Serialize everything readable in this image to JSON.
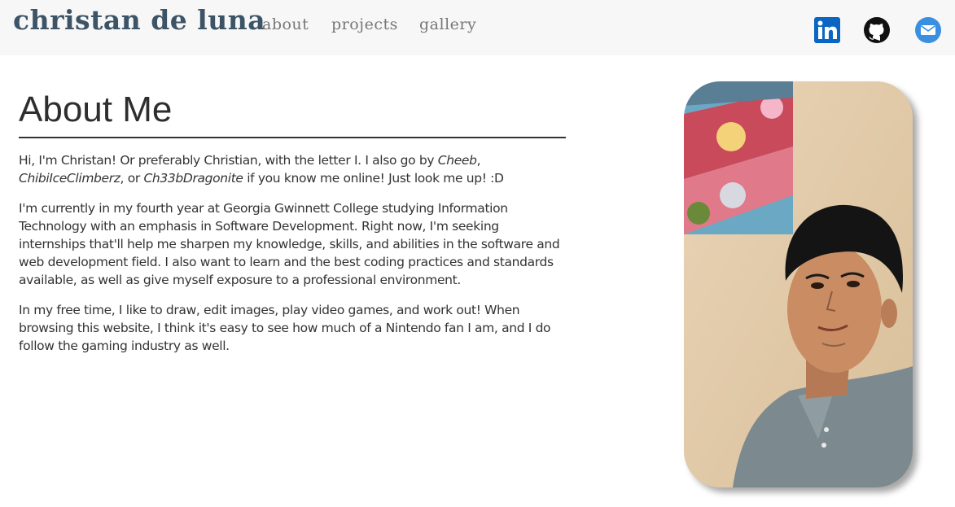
{
  "header": {
    "brand": "christan de luna",
    "nav": [
      {
        "label": "about"
      },
      {
        "label": "projects"
      },
      {
        "label": "gallery"
      }
    ],
    "social": [
      "linkedin-icon",
      "github-icon",
      "email-icon"
    ]
  },
  "about": {
    "title": "About Me",
    "p1": {
      "pre": "Hi, I'm Christan! Or preferably Christian, with the letter I. I also go by ",
      "alias1": "Cheeb",
      "sep1": ", ",
      "alias2": "ChibiIceClimberz",
      "sep2": ", or ",
      "alias3": "Ch33bDragonite",
      "post": " if you know me online! Just look me up! :D"
    },
    "p2": "I'm currently in my fourth year at Georgia Gwinnett College studying Information Technology with an emphasis in Software Development. Right now, I'm seeking internships that'll help me sharpen my knowledge, skills, and abilities in the software and web development field. I also want to learn and the best coding practices and standards available, as well as give myself exposure to a professional environment.",
    "p3": "In my free time, I like to draw, edit images, play video games, and work out! When browsing this website, I think it's easy to see how much of a Nintendo fan I am, and I do follow the gaming industry as well."
  },
  "colors": {
    "brand": "#3d5467",
    "nav": "#777777",
    "linkedin": "#0a66c2",
    "email": "#3b8fe0",
    "topbar": "#f7f7f7"
  }
}
